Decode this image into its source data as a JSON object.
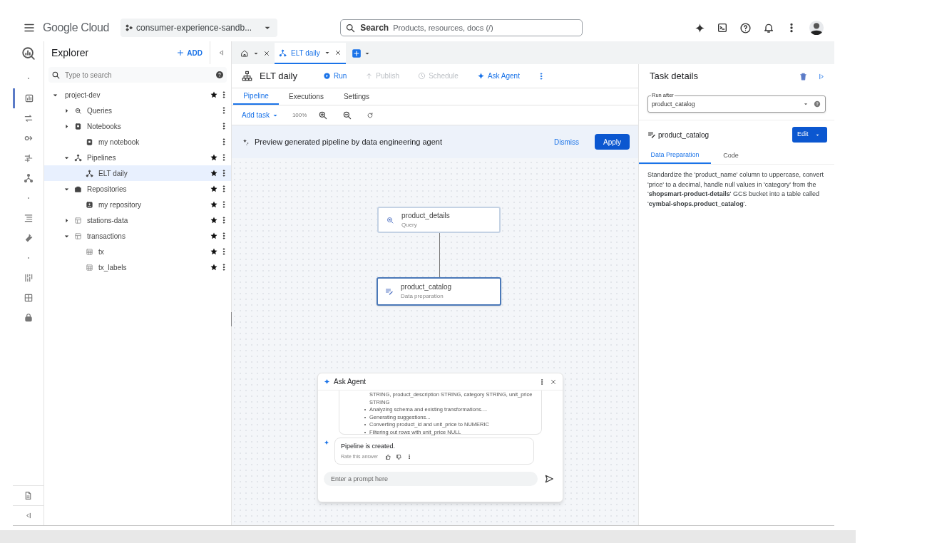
{
  "top_bar": {
    "logo": "Google Cloud",
    "project": "consumer-experience-sandb...",
    "search": {
      "label": "Search",
      "placeholder": "Products, resources, docs (/)"
    }
  },
  "rail_items": [
    {
      "kind": "dot",
      "selected": false
    },
    {
      "kind": "studio",
      "selected": true
    },
    {
      "kind": "transfer",
      "selected": false
    },
    {
      "kind": "link",
      "selected": false
    },
    {
      "kind": "flow",
      "selected": false
    },
    {
      "kind": "pipeline",
      "selected": false
    },
    {
      "kind": "dot",
      "selected": false
    },
    {
      "kind": "list",
      "selected": false
    },
    {
      "kind": "wrench",
      "selected": false
    },
    {
      "kind": "dot",
      "selected": false
    },
    {
      "kind": "grid",
      "selected": false
    },
    {
      "kind": "dashboard",
      "selected": false
    },
    {
      "kind": "lock",
      "selected": false
    }
  ],
  "explorer": {
    "title": "Explorer",
    "add": "ADD",
    "search_placeholder": "Type to search",
    "tree": [
      {
        "label": "project-dev",
        "expanded": true,
        "starred": true,
        "selected": false,
        "children": [
          {
            "label": "Queries",
            "kind": "query",
            "expanded": false,
            "starred": false,
            "selected": false
          },
          {
            "label": "Notebooks",
            "kind": "notebook",
            "expanded": false,
            "starred": false,
            "selected": false,
            "children": [
              {
                "label": "my notebook",
                "kind": "notebook",
                "starred": false,
                "selected": false
              }
            ]
          },
          {
            "label": "Pipelines",
            "kind": "pipeline",
            "expanded": true,
            "starred": true,
            "selected": false,
            "children": [
              {
                "label": "ELT daily",
                "kind": "pipeline",
                "starred": true,
                "selected": true
              }
            ]
          },
          {
            "label": "Repositories",
            "kind": "repository",
            "expanded": true,
            "starred": true,
            "selected": false,
            "children": [
              {
                "label": "my repository",
                "kind": "repo-item",
                "starred": true,
                "selected": false
              }
            ]
          },
          {
            "label": "stations-data",
            "kind": "dataset",
            "expanded": false,
            "starred": true,
            "selected": false
          },
          {
            "label": "transactions",
            "kind": "dataset",
            "expanded": true,
            "starred": true,
            "selected": false,
            "children": [
              {
                "label": "tx",
                "kind": "table",
                "starred": true,
                "selected": false
              },
              {
                "label": "tx_labels",
                "kind": "table",
                "starred": true,
                "selected": false
              }
            ]
          }
        ]
      }
    ]
  },
  "editor_tabs": [
    {
      "kind": "home",
      "selected": false
    },
    {
      "kind": "pipeline",
      "label": "ELT daily",
      "selected": true
    }
  ],
  "toolbar": {
    "title": "ELT daily",
    "actions": [
      {
        "label": "Run",
        "kind": "run",
        "disabled": false
      },
      {
        "label": "Publish",
        "kind": "publish",
        "disabled": true
      },
      {
        "label": "Schedule",
        "kind": "schedule",
        "disabled": true
      },
      {
        "label": "Ask Agent",
        "kind": "agent",
        "disabled": false
      }
    ]
  },
  "pipeline_tabs": [
    {
      "label": "Pipeline",
      "selected": true
    },
    {
      "label": "Executions",
      "selected": false
    },
    {
      "label": "Settings",
      "selected": false
    }
  ],
  "canvas_tools": {
    "add_task": "Add task",
    "zoom": "100%"
  },
  "banner": {
    "text": "Preview generated pipeline by data engineering agent",
    "dismiss": "Dismiss",
    "apply": "Apply"
  },
  "nodes": [
    {
      "name": "product_details",
      "type": "Query",
      "kind": "query",
      "selected": false
    },
    {
      "name": "product_catalog",
      "type": "Data preparation",
      "kind": "prep",
      "selected": true
    }
  ],
  "ask_agent": {
    "title": "Ask Agent",
    "log_continuation": "STRING, product_description STRING, category STRING, unit_price STRING",
    "log_bullets": [
      "Analyzing schema and existing transformations....",
      "Generating suggestions...",
      "Converting product_id and unit_price to NUMERIC",
      "Filtering out rows with unit_price NULL"
    ],
    "reply": "Pipeline is created.",
    "rate": "Rate this answer",
    "prompt_placeholder": "Enter a prompt here"
  },
  "task_details": {
    "title": "Task details",
    "run_after_label": "Run after",
    "run_after_value": "product_catalog",
    "task_name": "product_catalog",
    "edit": "Edit",
    "tabs": [
      {
        "label": "Data Preparation",
        "selected": true
      },
      {
        "label": "Code",
        "selected": false
      }
    ],
    "description": "Standardize the 'product_name' column to uppercase, convert 'price' to a decimal, handle null values in 'category' from the '**shopsmart-product-details**' GCS bucket into a table called '**cymbal-shops.product_catalog**'."
  }
}
